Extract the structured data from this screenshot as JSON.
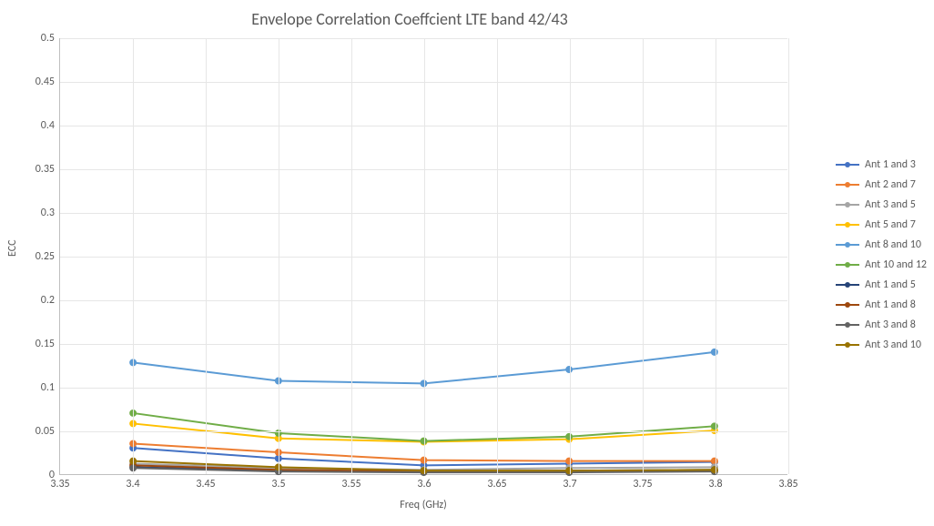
{
  "chart_data": {
    "type": "line",
    "title": "Envelope Correlation Coeffcient LTE band 42/43",
    "xlabel": "Freq (GHz)",
    "ylabel": "ECC",
    "xlim": [
      3.35,
      3.85
    ],
    "ylim": [
      0,
      0.5
    ],
    "x_ticks": [
      3.35,
      3.4,
      3.45,
      3.5,
      3.55,
      3.6,
      3.65,
      3.7,
      3.75,
      3.8,
      3.85
    ],
    "y_ticks": [
      0,
      0.05,
      0.1,
      0.15,
      0.2,
      0.25,
      0.3,
      0.35,
      0.4,
      0.45,
      0.5
    ],
    "x": [
      3.4,
      3.5,
      3.6,
      3.7,
      3.8
    ],
    "series": [
      {
        "name": "Ant 1 and 3",
        "color": "#4472c4",
        "values": [
          0.03,
          0.018,
          0.01,
          0.012,
          0.014
        ]
      },
      {
        "name": "Ant 2 and 7",
        "color": "#ed7d31",
        "values": [
          0.035,
          0.025,
          0.016,
          0.015,
          0.015
        ]
      },
      {
        "name": "Ant 3 and 5",
        "color": "#a5a5a5",
        "values": [
          0.012,
          0.007,
          0.005,
          0.007,
          0.008
        ]
      },
      {
        "name": "Ant 5 and 7",
        "color": "#ffc000",
        "values": [
          0.058,
          0.041,
          0.037,
          0.04,
          0.05
        ]
      },
      {
        "name": "Ant 8 and 10",
        "color": "#5b9bd5",
        "values": [
          0.128,
          0.107,
          0.104,
          0.12,
          0.14
        ]
      },
      {
        "name": "Ant 10 and 12",
        "color": "#70ad47",
        "values": [
          0.07,
          0.047,
          0.038,
          0.043,
          0.055
        ]
      },
      {
        "name": "Ant 1 and 5",
        "color": "#264478",
        "values": [
          0.008,
          0.004,
          0.003,
          0.004,
          0.005
        ]
      },
      {
        "name": "Ant 1 and 8",
        "color": "#9e480e",
        "values": [
          0.01,
          0.005,
          0.003,
          0.003,
          0.004
        ]
      },
      {
        "name": "Ant 3 and 8",
        "color": "#636363",
        "values": [
          0.007,
          0.003,
          0.002,
          0.002,
          0.003
        ]
      },
      {
        "name": "Ant 3 and 10",
        "color": "#997300",
        "values": [
          0.015,
          0.008,
          0.004,
          0.004,
          0.005
        ]
      }
    ]
  }
}
